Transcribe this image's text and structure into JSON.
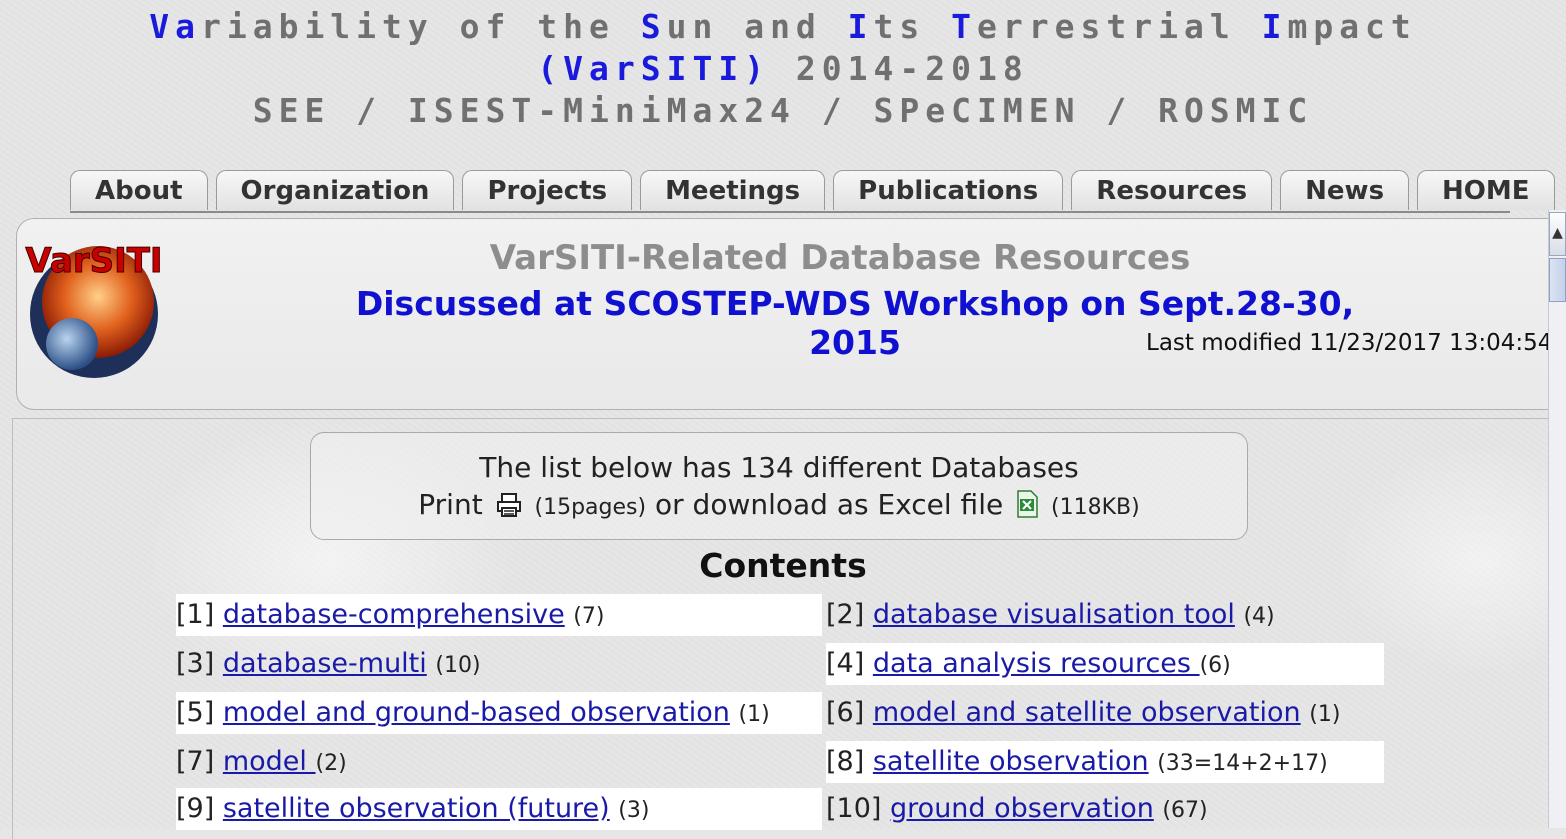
{
  "header": {
    "line1": [
      {
        "text": "Va",
        "hl": true
      },
      {
        "text": "ri",
        "hl": false
      },
      {
        "text": "ability of the ",
        "hl": false
      },
      {
        "text": "S",
        "hl": true
      },
      {
        "text": "un and ",
        "hl": false
      },
      {
        "text": "I",
        "hl": true
      },
      {
        "text": "ts ",
        "hl": false
      },
      {
        "text": "T",
        "hl": true
      },
      {
        "text": "errestrial ",
        "hl": false
      },
      {
        "text": "I",
        "hl": true
      },
      {
        "text": "mpact",
        "hl": false
      }
    ],
    "line2_acronym": "(VarSITI)",
    "line2_years": " 2014-2018",
    "line3": "SEE / ISEST-MiniMax24 / SPeCIMEN / ROSMIC"
  },
  "tabs": [
    "About",
    "Organization",
    "Projects",
    "Meetings",
    "Publications",
    "Resources",
    "News",
    "HOME"
  ],
  "banner": {
    "logo_text": "VarSITI",
    "title": "VarSITI-Related Database Resources",
    "subtitle": "Discussed at SCOSTEP-WDS Workshop on Sept.28-30, 2015",
    "last_modified": "Last modified 11/23/2017 13:04:54"
  },
  "infobox": {
    "line1": "The list below has 134 different Databases",
    "print_label": "Print",
    "print_pages": "(15pages)",
    "download_text": "or download as Excel file",
    "excel_size": "(118KB)",
    "icons": [
      "printer-icon",
      "excel-file-icon"
    ]
  },
  "contents": {
    "title": "Contents",
    "items": [
      {
        "num": "[1]",
        "label": "database-comprehensive",
        "count": "(7)"
      },
      {
        "num": "[2]",
        "label": "database visualisation tool",
        "count": "(4)"
      },
      {
        "num": "[3]",
        "label": "database-multi",
        "count": "(10)"
      },
      {
        "num": "[4]",
        "label": "data analysis resources ",
        "count": "(6)"
      },
      {
        "num": "[5]",
        "label": "model and ground-based observation",
        "count": "(1)"
      },
      {
        "num": "[6]",
        "label": "model and satellite observation",
        "count": "(1)"
      },
      {
        "num": "[7]",
        "label": "model ",
        "count": "(2)"
      },
      {
        "num": "[8]",
        "label": "satellite observation",
        "count": "(33=14+2+17)"
      },
      {
        "num": "[9]",
        "label": "satellite observation (future)",
        "count": "(3)"
      },
      {
        "num": "[10]",
        "label": "ground observation",
        "count": "(67)"
      }
    ]
  },
  "colors": {
    "accent": "#1a1adc",
    "link": "#1a1aa8",
    "muted": "#707070"
  }
}
